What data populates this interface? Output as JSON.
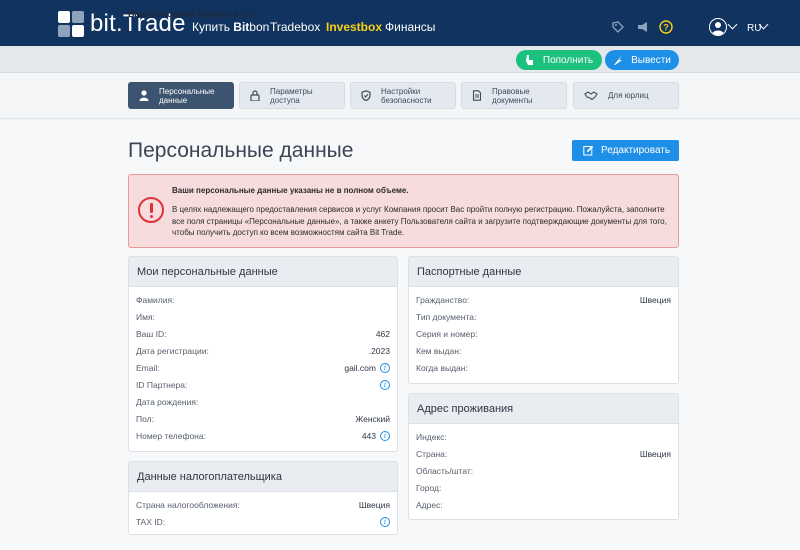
{
  "header": {
    "logo": "bit.Trade",
    "nav": [
      {
        "prefix": "Купить ",
        "bold": "Bit",
        "suffix": "bon"
      },
      {
        "label": "Tradebox"
      },
      {
        "label": "Investbox"
      },
      {
        "label": "Финансы"
      }
    ],
    "lang": "RU"
  },
  "balance": {
    "label": "Ваш Основной баланс:",
    "value": "Ƀ 0,00",
    "deposit": "Пополнить",
    "withdraw": "Вывести"
  },
  "tabs": [
    {
      "label": "Персональные данные",
      "icon": "user-icon"
    },
    {
      "label": "Параметры доступа",
      "icon": "lock-icon"
    },
    {
      "label": "Настройки безопасности",
      "icon": "shield-icon"
    },
    {
      "label": "Правовые документы",
      "icon": "document-icon"
    },
    {
      "label": "Для юрлиц",
      "icon": "handshake-icon"
    }
  ],
  "page": {
    "title": "Персональные данные",
    "edit": "Редактировать"
  },
  "alert": {
    "title": "Ваши персональные данные указаны не в полном объеме.",
    "text": "В целях надлежащего предоставления сервисов и услуг Компания просит Вас пройти полную регистрацию. Пожалуйста, заполните все поля страницы «Персональные данные», а также анкету Пользователя сайта и загрузите подтверждающие документы для того, чтобы получить доступ ко всем возможностям сайта Bit Trade."
  },
  "personal": {
    "title": "Мои персональные данные",
    "rows": [
      {
        "label": "Фамилия:",
        "value": ""
      },
      {
        "label": "Имя:",
        "value": ""
      },
      {
        "label": "Ваш ID:",
        "value": "462"
      },
      {
        "label": "Дата регистрации:",
        "value": ".2023"
      },
      {
        "label": "Email:",
        "value": "gail.com"
      },
      {
        "label": "ID Партнера:",
        "value": ""
      },
      {
        "label": "Дата рождения:",
        "value": ""
      },
      {
        "label": "Пол:",
        "value": "Женский"
      },
      {
        "label": "Номер телефона:",
        "value": "443"
      }
    ]
  },
  "tax": {
    "title": "Данные налогоплательщика",
    "rows": [
      {
        "label": "Страна налогообложения:",
        "value": "Швеция"
      },
      {
        "label": "TAX ID:",
        "value": ""
      }
    ]
  },
  "passport": {
    "title": "Паспортные данные",
    "rows": [
      {
        "label": "Гражданство:",
        "value": "Швеция"
      },
      {
        "label": "Тип документа:",
        "value": ""
      },
      {
        "label": "Серия и номер:",
        "value": ""
      },
      {
        "label": "Кем выдан:",
        "value": ""
      },
      {
        "label": "Когда выдан:",
        "value": ""
      }
    ]
  },
  "address": {
    "title": "Адрес проживания",
    "rows": [
      {
        "label": "Индекс:",
        "value": ""
      },
      {
        "label": "Страна:",
        "value": "Швеция"
      },
      {
        "label": "Область/штат:",
        "value": ""
      },
      {
        "label": "Город:",
        "value": ""
      },
      {
        "label": "Адрес:",
        "value": ""
      }
    ]
  },
  "colors": {
    "navy": "#11335f",
    "accent": "#f7d117",
    "green": "#1bc17d",
    "blue": "#1d8fe6",
    "alert_red": "#e0313a"
  }
}
